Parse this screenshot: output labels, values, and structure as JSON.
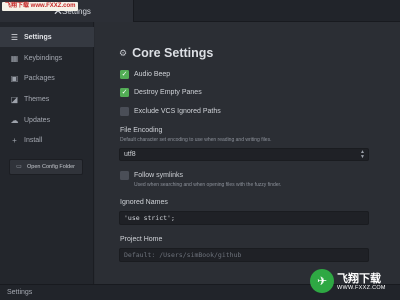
{
  "watermark": "飞翔下载 www.FXXZ.com",
  "tab": {
    "title": "Settings",
    "close_icon": "close-icon"
  },
  "sidebar": {
    "items": [
      {
        "label": "Settings",
        "icon": "sliders-icon",
        "active": true
      },
      {
        "label": "Keybindings",
        "icon": "keyboard-icon",
        "active": false
      },
      {
        "label": "Packages",
        "icon": "package-icon",
        "active": false
      },
      {
        "label": "Themes",
        "icon": "paintcan-icon",
        "active": false
      },
      {
        "label": "Updates",
        "icon": "cloud-download-icon",
        "active": false
      },
      {
        "label": "Install",
        "icon": "plus-icon",
        "active": false
      }
    ],
    "open_config_label": "Open Config Folder"
  },
  "main": {
    "section_title": "Core Settings",
    "section_icon": "gear-icon",
    "options": [
      {
        "label": "Audio Beep",
        "checked": true
      },
      {
        "label": "Destroy Empty Panes",
        "checked": true
      },
      {
        "label": "Exclude VCS Ignored Paths",
        "checked": false
      }
    ],
    "file_encoding": {
      "label": "File Encoding",
      "description": "Default character set encoding to use when reading and writing files.",
      "value": "utf8"
    },
    "follow_symlinks": {
      "label": "Follow symlinks",
      "description": "Used when searching and when opening files with the fuzzy finder.",
      "checked": false
    },
    "ignored_names": {
      "label": "Ignored Names",
      "value": "'use strict';"
    },
    "project_home": {
      "label": "Project Home",
      "placeholder": "Default: /Users/simBook/github"
    }
  },
  "statusbar": {
    "text": "Settings"
  },
  "logo": {
    "title": "飞翔下载",
    "url": "WWW.FXXZ.COM"
  },
  "colors": {
    "checkbox_checked": "#52ad55",
    "background": "#2b2e34",
    "sidebar_active": "#353941"
  }
}
